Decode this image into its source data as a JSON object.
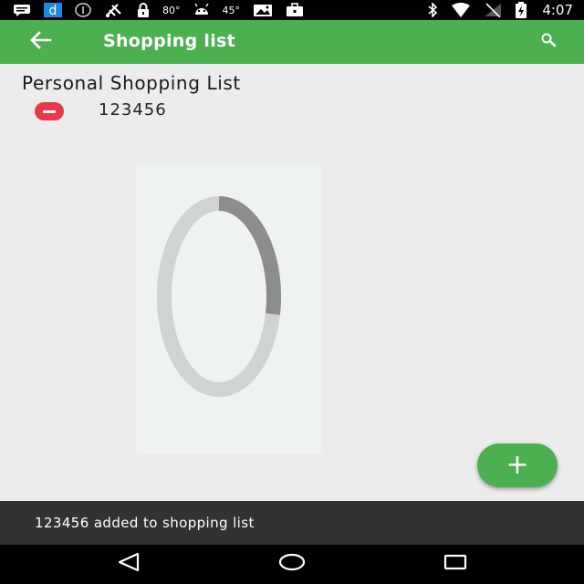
{
  "status_bar": {
    "temp_1": "80°",
    "temp_2": "45°",
    "time": "4:07"
  },
  "app_bar": {
    "title": "Shopping list",
    "back_icon": "arrow-back-icon",
    "search_icon": "search-icon"
  },
  "list": {
    "title": "Personal Shopping List",
    "items": [
      {
        "name": "123456",
        "action_icon": "remove-circle-icon"
      }
    ]
  },
  "fab": {
    "label": "+",
    "icon": "add-icon"
  },
  "snackbar": {
    "message": "123456 added to shopping list"
  },
  "progress": {
    "fraction": 0.28
  },
  "colors": {
    "primary": "#4caf50",
    "remove": "#e8394a",
    "snackbar": "#323232",
    "background": "#ececec"
  }
}
